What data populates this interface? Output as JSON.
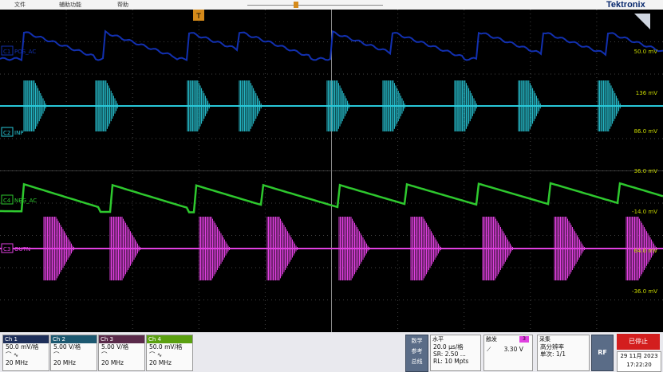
{
  "menu": {
    "file": "文件",
    "assist": "辅助功能",
    "help": "帮助"
  },
  "brand": "Tektronix",
  "trigger_marker": "T",
  "channels_on_screen": [
    {
      "tag": "C1",
      "label": "POS_AC",
      "color": "#1230b0",
      "scale_label": "50.0 mV"
    },
    {
      "tag": "C2",
      "label": "INP",
      "color": "#28c8d8",
      "scale_label_top": "136 mV",
      "scale_label_bottom": "86.0 mV"
    },
    {
      "tag": "C4",
      "label": "NEG_AC",
      "color": "#2ec82e",
      "scale_label_top": "36.0 mV",
      "scale_label_bottom": "-14.0 mV"
    },
    {
      "tag": "C3",
      "label": "OUTN",
      "color": "#e040e0",
      "scale_label_top": "64.0 mV",
      "scale_label_bottom": "-36.0 mV"
    }
  ],
  "ch_boxes": [
    {
      "title": "Ch 1",
      "scale": "50.0 mV/格",
      "bw": "20 MHz",
      "color": "#1e2f5a"
    },
    {
      "title": "Ch 2",
      "scale": "5.00 V/格",
      "bw": "20 MHz",
      "color": "#1c5870"
    },
    {
      "title": "Ch 3",
      "scale": "5.00 V/格",
      "bw": "20 MHz",
      "color": "#5a2a4a"
    },
    {
      "title": "Ch 4",
      "scale": "50.0 mV/格",
      "bw": "20 MHz",
      "color": "#5aa010"
    }
  ],
  "math": {
    "l1": "数学",
    "l2": "参考",
    "l3": "总线"
  },
  "horizontal": {
    "title": "水平",
    "scale": "20.0 µs/格",
    "sr": "SR: 2.50 ...",
    "rl": "RL: 10 Mpts"
  },
  "trigger": {
    "title": "触发",
    "ch": "3",
    "level": "3.30 V"
  },
  "acquire": {
    "title": "采集",
    "mode": "高分辨率",
    "count": "单次: 1/1"
  },
  "rf": "RF",
  "run_state": "已停止",
  "date": "29 11月 2023",
  "time": "17:22:20"
}
